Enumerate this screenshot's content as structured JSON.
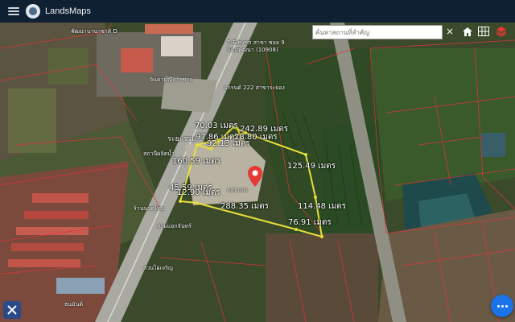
{
  "app": {
    "title": "LandsMaps"
  },
  "search": {
    "placeholder": "ค้นหาสถานที่สำคัญ",
    "value": ""
  },
  "controls": {
    "clear_label": "×"
  },
  "measurements": [
    "70.03 เมตร",
    "242.89 เมตร",
    "97.86 เมตร",
    "28.80 เมตร",
    "92.13 เมตร",
    "160.59 เมตร",
    "125.49 เมตร",
    "45.59 เมตร",
    "12.90 เมตร",
    "288.35 เมตร",
    "114.48 เมตร",
    "76.91 เมตร"
  ],
  "map_labels": [
    "พัฒนานานาชาติ D",
    "7-Eleven สาขา ซอย 9",
    "นิคมพัฒนา (10908)",
    "จินดามณีการช่าง",
    "แกรนด์ 222 สาขาระยอง",
    "ระยะรวม",
    "สถานีผลิตน้ำ",
    "ร้านนวดไทย",
    "สามแยกจันทร์",
    "แสนแสง",
    "สวนไผ่เจริญ",
    "ธนมันต์"
  ],
  "colors": {
    "topbar": "#0f2033",
    "polygon": "#e6de3a",
    "accent": "#1a73e8",
    "pin": "#e53935"
  }
}
